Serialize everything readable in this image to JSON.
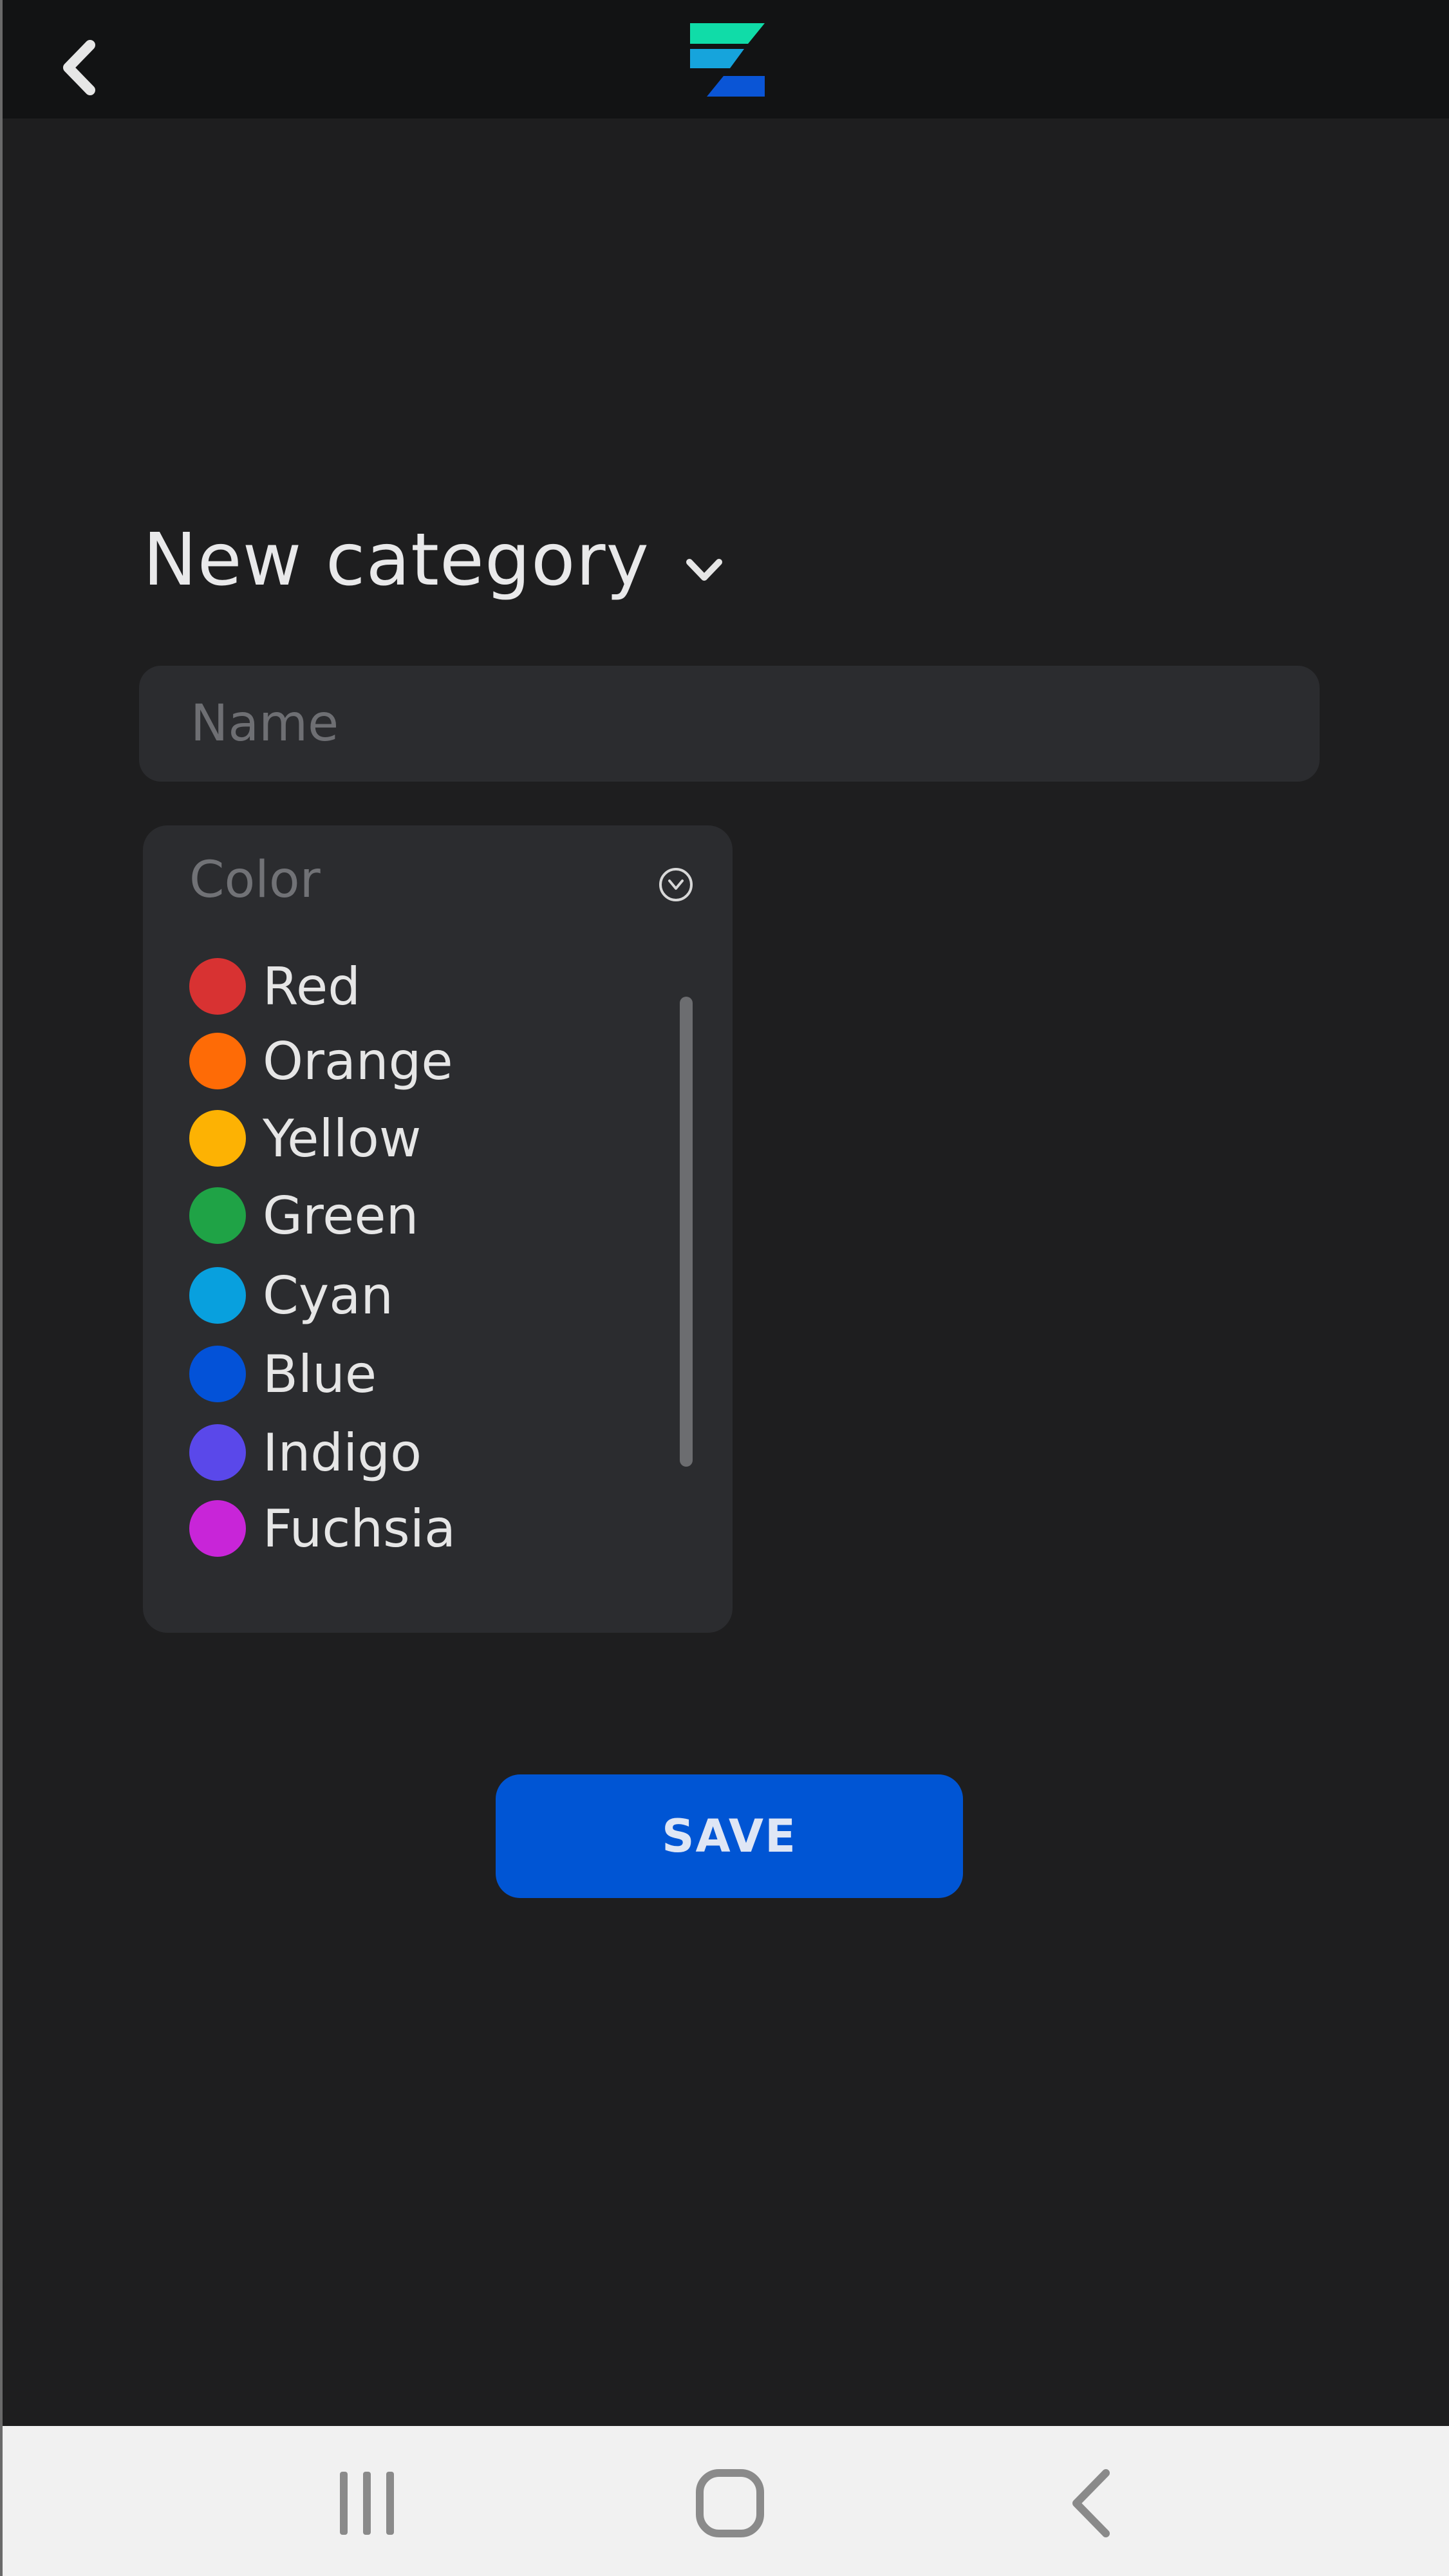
{
  "header": {
    "back_icon": "chevron-left-icon",
    "logo": "app-logo"
  },
  "form": {
    "title": "New category",
    "title_icon": "chevron-down-icon",
    "name_placeholder": "Name",
    "color_dropdown": {
      "label": "Color",
      "collapse_icon": "chevron-circle-icon",
      "options": [
        {
          "label": "Red",
          "color": "#d83232"
        },
        {
          "label": "Orange",
          "color": "#fe6b06"
        },
        {
          "label": "Yellow",
          "color": "#fdb203"
        },
        {
          "label": "Green",
          "color": "#1fa346"
        },
        {
          "label": "Cyan",
          "color": "#08a0de"
        },
        {
          "label": "Blue",
          "color": "#0352d8"
        },
        {
          "label": "Indigo",
          "color": "#5a48ea"
        },
        {
          "label": "Fuchsia",
          "color": "#c825d8"
        }
      ]
    },
    "save_label": "SAVE"
  },
  "system_nav": {
    "recents_icon": "recents-icon",
    "home_icon": "home-icon",
    "back_icon": "back-icon"
  },
  "colors": {
    "background": "#1e1e1f",
    "topbar": "#121314",
    "panel": "#2b2c2f",
    "accent": "#0055d4",
    "logo_teal": "#10dca8",
    "logo_cyan": "#16a4dc",
    "logo_blue": "#0a55d6"
  }
}
